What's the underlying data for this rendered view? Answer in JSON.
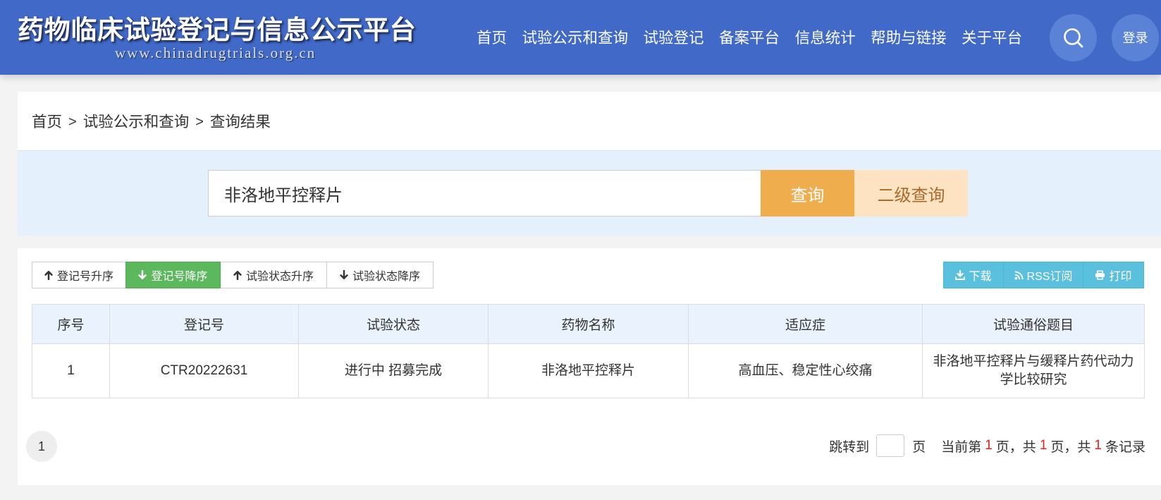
{
  "header": {
    "title": "药物临床试验登记与信息公示平台",
    "url_text": "www.chinadrugtrials.org.cn",
    "nav": [
      {
        "label": "首页"
      },
      {
        "label": "试验公示和查询"
      },
      {
        "label": "试验登记"
      },
      {
        "label": "备案平台"
      },
      {
        "label": "信息统计"
      },
      {
        "label": "帮助与链接"
      },
      {
        "label": "关于平台"
      }
    ],
    "search_button": {
      "icon": "search-icon"
    },
    "login_label": "登录"
  },
  "breadcrumb": {
    "items": [
      "首页",
      "试验公示和查询",
      "查询结果"
    ],
    "separator": ">"
  },
  "search": {
    "value": "非洛地平控释片",
    "query_label": "查询",
    "advanced_label": "二级查询"
  },
  "toolbar": {
    "sort_buttons": [
      {
        "icon": "arrow-up-icon",
        "label": "登记号升序",
        "active": false
      },
      {
        "icon": "arrow-down-icon",
        "label": "登记号降序",
        "active": true
      },
      {
        "icon": "arrow-up-icon",
        "label": "试验状态升序",
        "active": false
      },
      {
        "icon": "arrow-down-icon",
        "label": "试验状态降序",
        "active": false
      }
    ],
    "action_buttons": [
      {
        "icon": "download-icon",
        "label": "下载"
      },
      {
        "icon": "rss-icon",
        "label": "RSS订阅"
      },
      {
        "icon": "print-icon",
        "label": "打印"
      }
    ]
  },
  "table": {
    "columns": [
      "序号",
      "登记号",
      "试验状态",
      "药物名称",
      "适应症",
      "试验通俗题目"
    ],
    "rows": [
      [
        "1",
        "CTR20222631",
        "进行中 招募完成",
        "非洛地平控释片",
        "高血压、稳定性心绞痛",
        "非洛地平控释片与缓释片药代动力学比较研究"
      ]
    ]
  },
  "pagination": {
    "pages": [
      "1"
    ],
    "jump_label": "跳转到",
    "page_unit": "页",
    "summary": {
      "prefix": "当前第",
      "current": "1",
      "unit_1": "页，共",
      "total_pages": "1",
      "unit_2": "页，共",
      "total_records": "1",
      "suffix": "条记录"
    }
  },
  "colors": {
    "header-bg": "#4169c8",
    "circle-bg": "#5a83d8",
    "page-bg": "#f3f3f3",
    "search-area-bg": "#e4f1fc",
    "query-btn-bg": "#f0ad4e",
    "advanced-btn-bg": "#fde3c1",
    "advanced-btn-text": "#a86a2b",
    "sort-active-bg": "#5cb85c",
    "action-btn-bg": "#5bc0de",
    "table-header-bg": "#eaf2fd",
    "highlight-red": "#e2231a"
  }
}
